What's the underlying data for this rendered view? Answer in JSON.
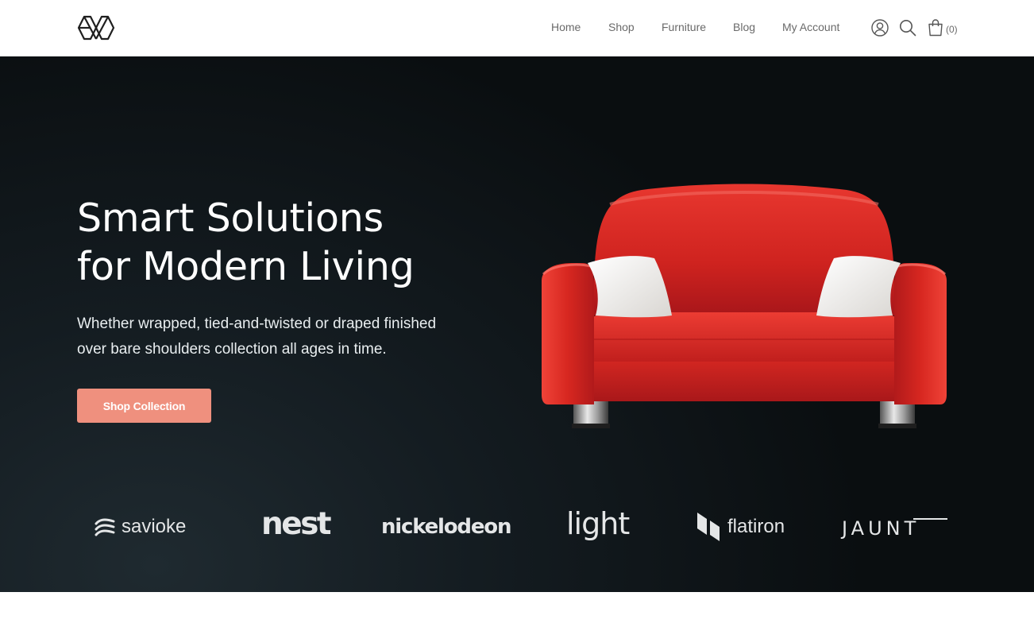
{
  "header": {
    "logo": "brand-logo",
    "nav": [
      {
        "label": "Home"
      },
      {
        "label": "Shop"
      },
      {
        "label": "Furniture"
      },
      {
        "label": "Blog"
      },
      {
        "label": "My Account"
      }
    ],
    "icons": [
      "user-icon",
      "search-icon",
      "shopping-bag-icon"
    ],
    "cart_count": "(0)"
  },
  "hero": {
    "title_line1": "Smart Solutions",
    "title_line2": "for Modern Living",
    "subtitle_line1": "Whether wrapped, tied-and-twisted or draped finished",
    "subtitle_line2": "over bare shoulders collection all ages in time.",
    "cta_label": "Shop Collection",
    "image": "red-sofa-image"
  },
  "brands": [
    {
      "name": "savioke"
    },
    {
      "name": "nest"
    },
    {
      "name": "nickelodeon"
    },
    {
      "name": "light"
    },
    {
      "name": "flatiron"
    },
    {
      "name": "JAUNT"
    }
  ],
  "colors": {
    "accent": "#ef907e",
    "hero_bg": "#10171b",
    "nav_text": "#6a6a6a",
    "sofa_red": "#d62a24"
  }
}
